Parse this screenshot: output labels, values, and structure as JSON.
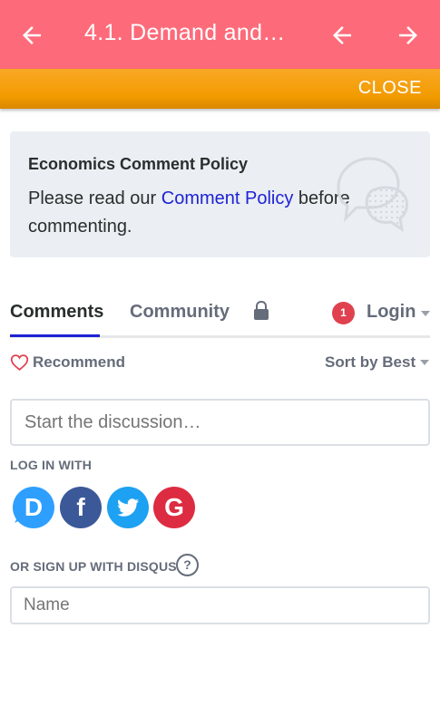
{
  "appbar": {
    "title": "4.1. Demand and S…",
    "back_icon": "arrow-left-icon",
    "prev_icon": "arrow-left-icon",
    "next_icon": "arrow-right-icon",
    "background": "#fd6b7a"
  },
  "closebar": {
    "close_label": "CLOSE",
    "background": "#f29b00"
  },
  "policy": {
    "title": "Economics Comment Policy",
    "text_before": "Please read our ",
    "link": "Comment Policy",
    "text_after": " before commenting.",
    "icon": "chat-bubbles-icon"
  },
  "tabs": {
    "comments": "Comments",
    "community": "Community",
    "lock_icon": "lock-icon",
    "notification_count": "1",
    "login": "Login"
  },
  "toolbar": {
    "recommend": "Recommend",
    "sort": "Sort by Best"
  },
  "discussion": {
    "placeholder": "Start the discussion…"
  },
  "login_with": {
    "label": "LOG IN WITH",
    "providers": [
      {
        "name": "disqus-icon",
        "glyph": "D",
        "color": "#2e9fff"
      },
      {
        "name": "facebook-icon",
        "glyph": "f",
        "color": "#3b5998"
      },
      {
        "name": "twitter-icon",
        "glyph": "",
        "color": "#1da1f2"
      },
      {
        "name": "google-icon",
        "glyph": "G",
        "color": "#dd2c41"
      }
    ]
  },
  "signup": {
    "label": "OR SIGN UP WITH DISQUS",
    "help": "?",
    "name_placeholder": "Name"
  },
  "colors": {
    "accent": "#1d23d4",
    "badge": "#e0414f"
  }
}
